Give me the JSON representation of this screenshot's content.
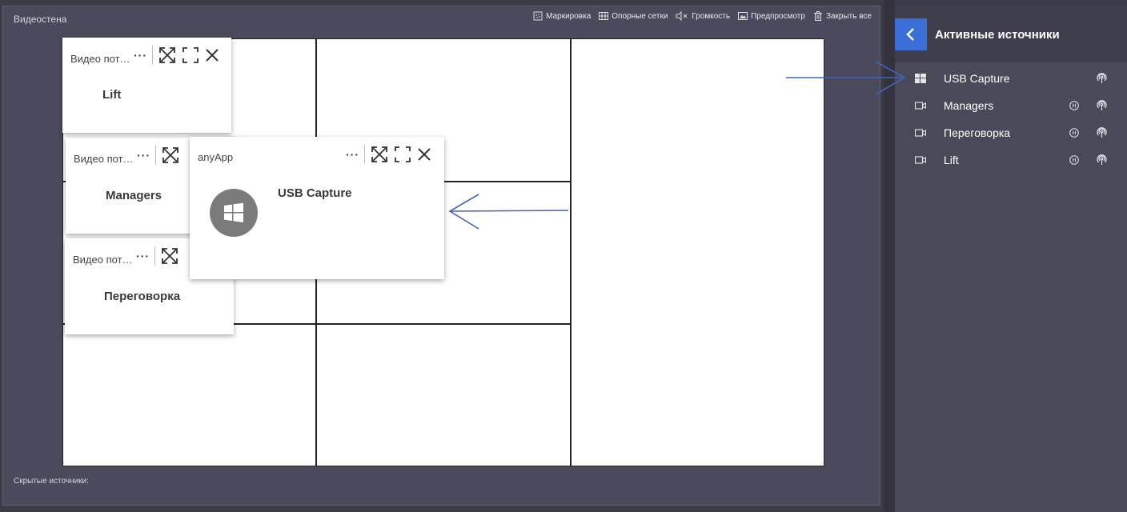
{
  "panel": {
    "title": "Видеостена",
    "hidden_sources_label": "Скрытые источники:"
  },
  "toolbar": {
    "markup": "Маркировка",
    "grids": "Опорные сетки",
    "volume": "Громкость",
    "preview": "Предпросмотр",
    "close_all": "Закрыть все"
  },
  "windows": {
    "lift": {
      "title": "Видео пот…",
      "name": "Lift"
    },
    "managers": {
      "title": "Видео пот…",
      "name": "Managers"
    },
    "peregovorka": {
      "title": "Видео пот…",
      "name": "Переговорка"
    },
    "usb": {
      "title": "anyApp",
      "name": "USB Capture",
      "icon": "windows-logo-icon"
    }
  },
  "sidebar": {
    "title": "Активные источники",
    "items": [
      {
        "label": "USB Capture",
        "icon": "windows-icon"
      },
      {
        "label": "Managers",
        "icon": "video-camera-icon"
      },
      {
        "label": "Переговорка",
        "icon": "video-camera-icon"
      },
      {
        "label": "Lift",
        "icon": "video-camera-icon"
      }
    ]
  },
  "colors": {
    "panel_bg": "#4b4a5c",
    "panel_border": "#3d5fc4",
    "accent": "#3a6fd8",
    "annotation_arrow": "#3f63b5",
    "sidebar_bg": "#4a4959"
  }
}
